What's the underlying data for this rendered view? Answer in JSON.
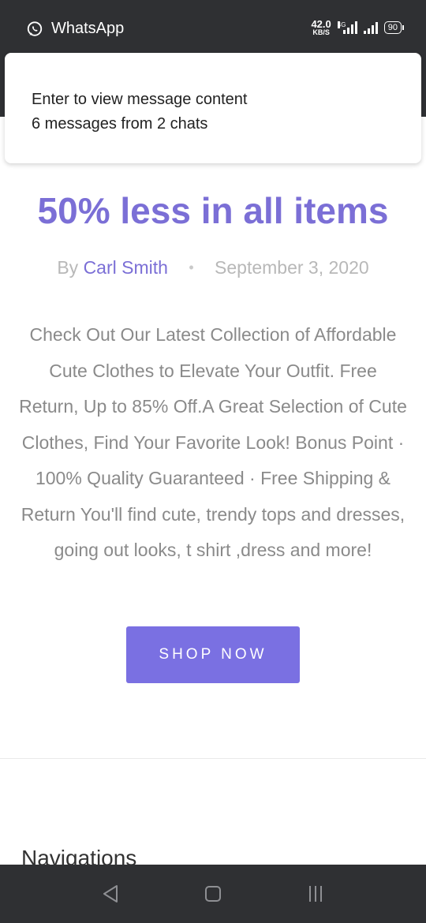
{
  "status_bar": {
    "app_name": "WhatsApp",
    "net_speed_value": "42.0",
    "net_speed_unit": "KB/S",
    "network_type": "4G",
    "battery": "90"
  },
  "notification": {
    "line1": "Enter to view message content",
    "line2": "6 messages from 2 chats"
  },
  "article": {
    "title": "50% less in all items",
    "by_prefix": "By",
    "author": "Carl Smith",
    "separator": "•",
    "date": "September 3, 2020",
    "description": "Check Out Our Latest Collection of Affordable Cute Clothes to Elevate Your Outfit. Free Return, Up to 85% Off.A Great Selection of Cute Clothes, Find Your Favorite Look! Bonus Point · 100% Quality Guaranteed · Free Shipping & Return You'll find cute, trendy tops and dresses, going out looks, t shirt ,dress and more!",
    "cta_label": "SHOP NOW"
  },
  "footer": {
    "heading": "Navigations"
  },
  "colors": {
    "accent": "#7a70e2",
    "title": "#7b6fd6",
    "system_bar": "#2f3033"
  },
  "icons": {
    "app": "whatsapp-icon",
    "back": "back-triangle-icon",
    "home": "home-square-icon",
    "recents": "recents-lines-icon"
  }
}
